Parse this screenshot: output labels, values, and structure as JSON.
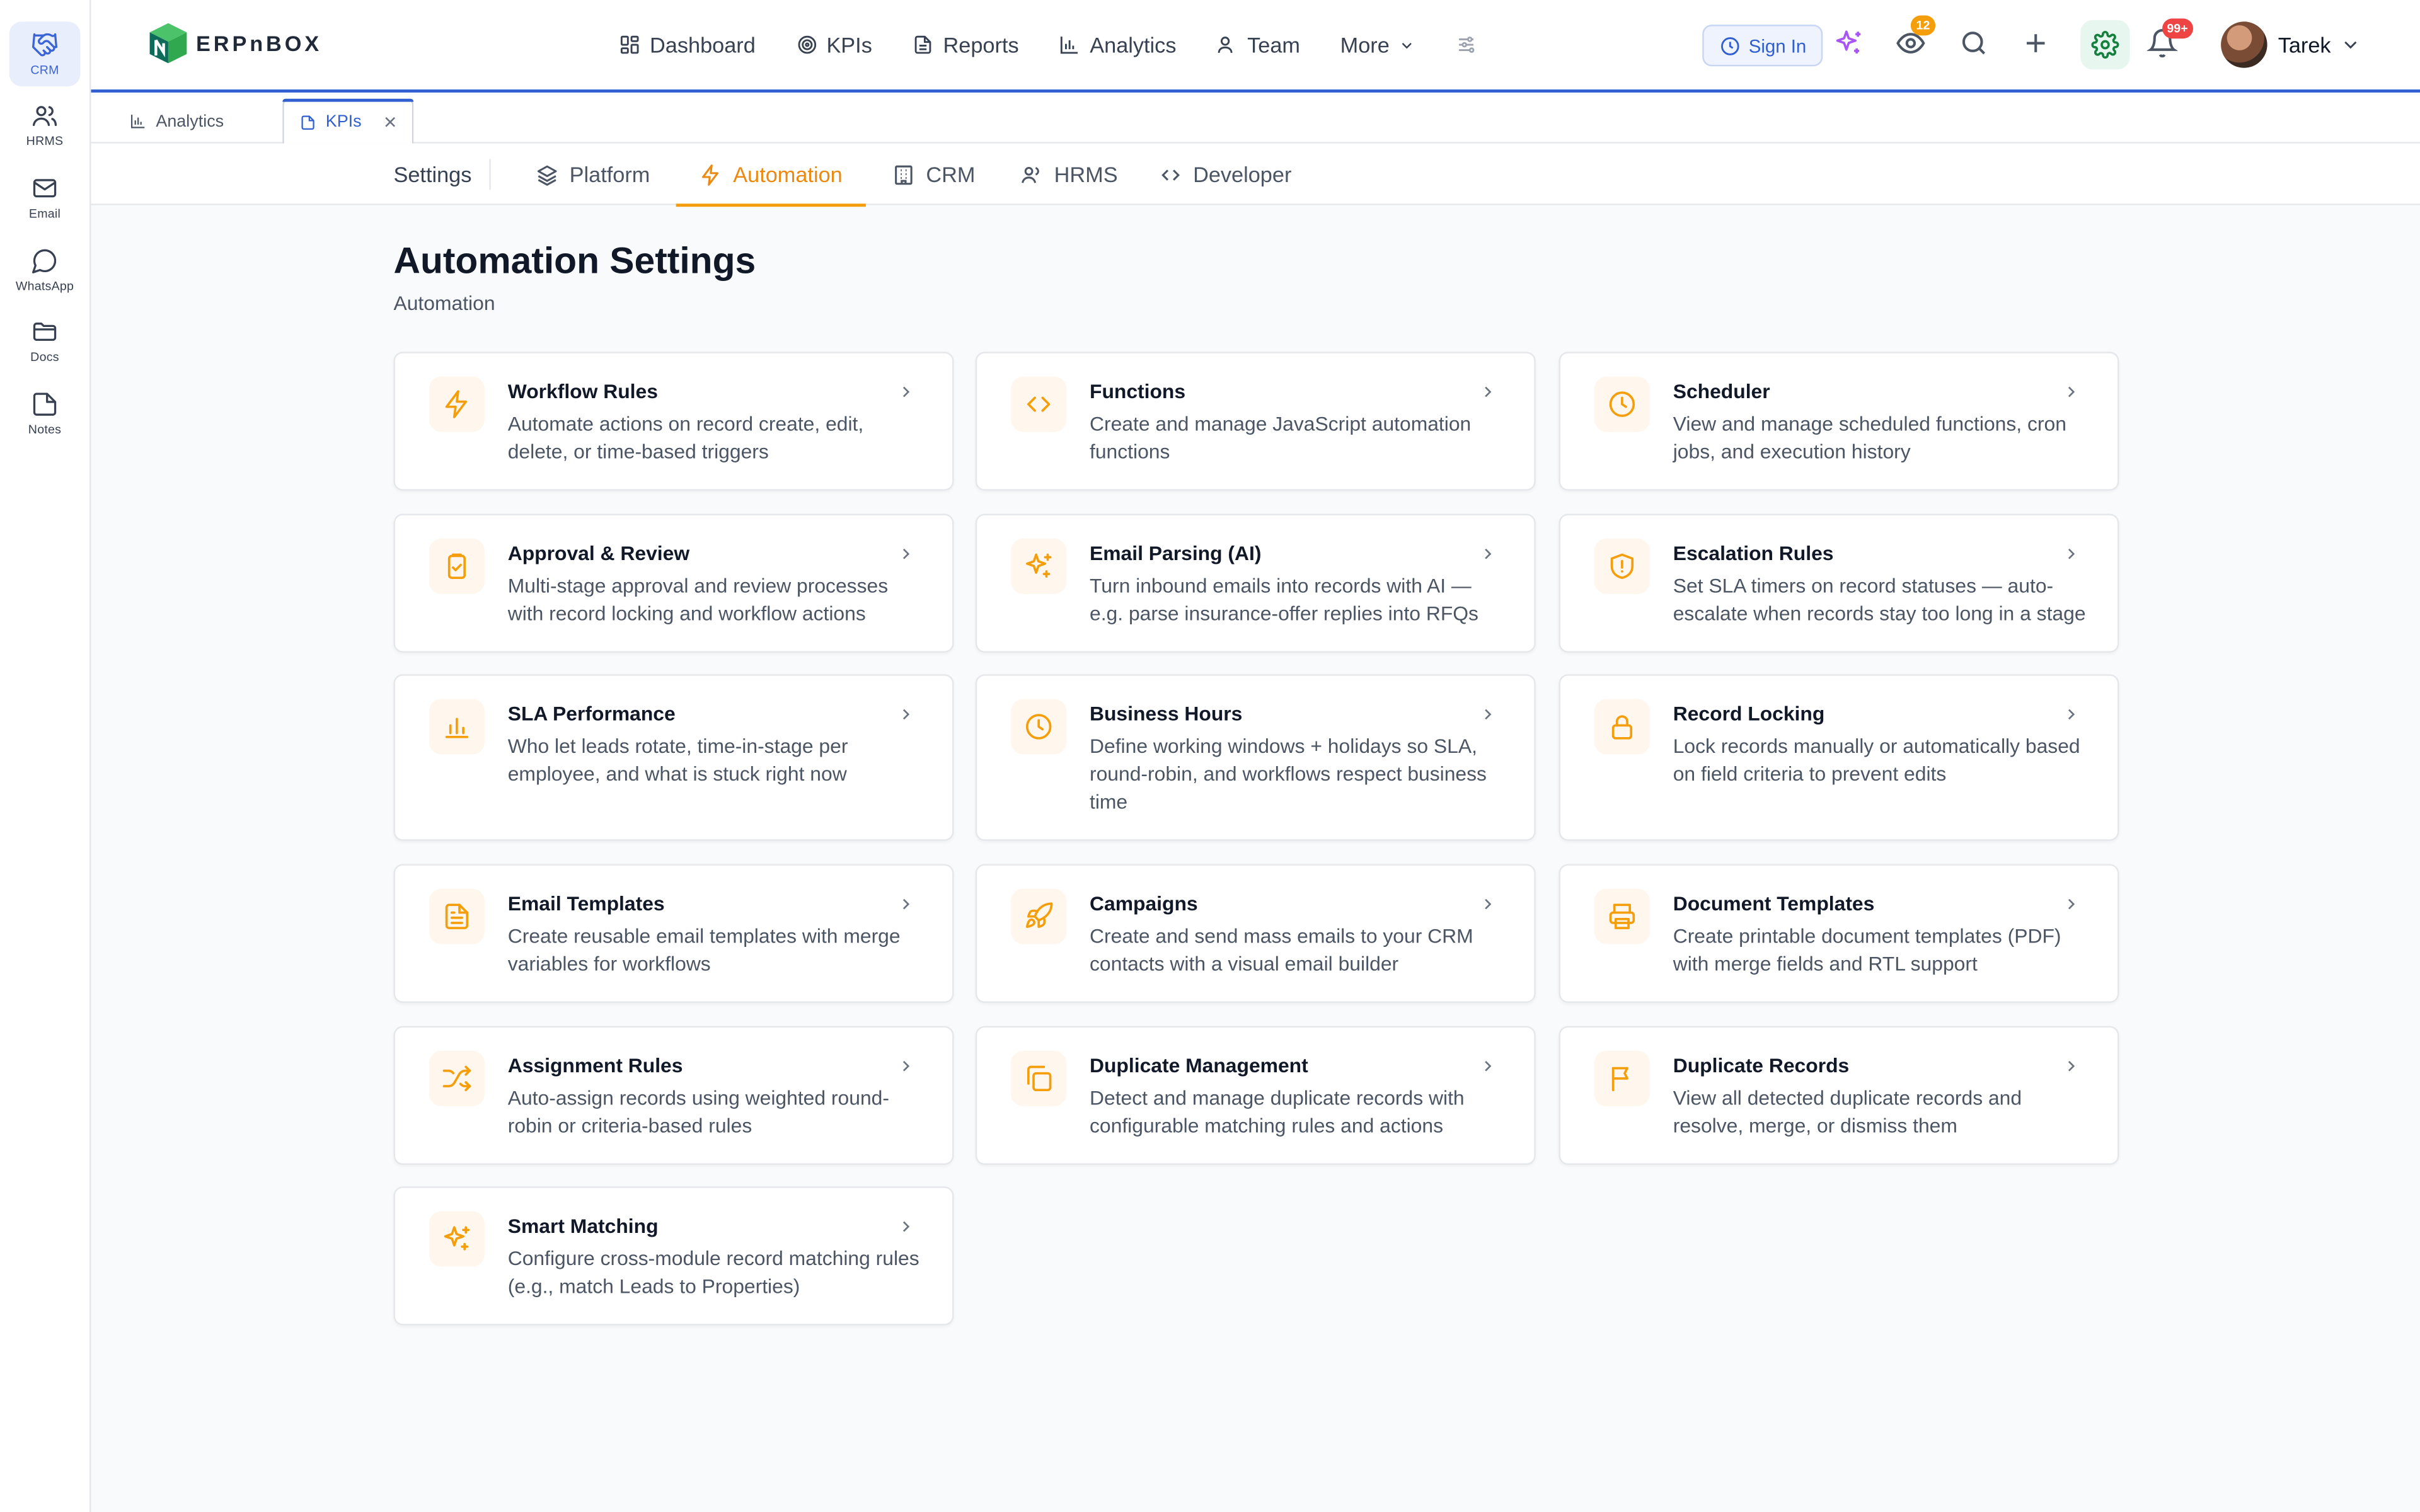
{
  "rail": [
    {
      "label": "CRM",
      "icon": "handshake-icon",
      "active": true
    },
    {
      "label": "HRMS",
      "icon": "users-icon"
    },
    {
      "label": "Email",
      "icon": "mail-icon"
    },
    {
      "label": "WhatsApp",
      "icon": "chat-bubble-icon"
    },
    {
      "label": "Docs",
      "icon": "folder-icon"
    },
    {
      "label": "Notes",
      "icon": "note-icon"
    }
  ],
  "brand": {
    "name": "ERPnBOX",
    "colors": {
      "green": "#2fa84f",
      "teal": "#0e6b5a"
    }
  },
  "nav": {
    "items": [
      {
        "label": "Dashboard",
        "icon": "dashboard-icon"
      },
      {
        "label": "KPIs",
        "icon": "target-icon"
      },
      {
        "label": "Reports",
        "icon": "report-icon"
      },
      {
        "label": "Analytics",
        "icon": "bar-chart-icon"
      },
      {
        "label": "Team",
        "icon": "user-icon"
      }
    ],
    "more_label": "More"
  },
  "top": {
    "sign_in": "Sign In",
    "watch_count": "12",
    "notif_count": "99+",
    "user_name": "Tarek"
  },
  "open_tabs": [
    {
      "label": "Analytics",
      "icon": "bar-chart-icon"
    },
    {
      "label": "KPIs",
      "icon": "file-icon",
      "active": true
    }
  ],
  "subnav": {
    "title": "Settings",
    "tabs": [
      {
        "label": "Platform",
        "icon": "layers-icon"
      },
      {
        "label": "Automation",
        "icon": "lightning-icon",
        "active": true
      },
      {
        "label": "CRM",
        "icon": "building-icon"
      },
      {
        "label": "HRMS",
        "icon": "users-icon"
      },
      {
        "label": "Developer",
        "icon": "code-icon"
      }
    ]
  },
  "page": {
    "title": "Automation Settings",
    "subtitle": "Automation"
  },
  "accent": "#f59e0b",
  "cards": [
    {
      "title": "Workflow Rules",
      "desc": "Automate actions on record create, edit, delete, or time-based triggers",
      "icon": "lightning-icon"
    },
    {
      "title": "Functions",
      "desc": "Create and manage JavaScript automation functions",
      "icon": "code-icon"
    },
    {
      "title": "Scheduler",
      "desc": "View and manage scheduled functions, cron jobs, and execution history",
      "icon": "clock-icon"
    },
    {
      "title": "Approval & Review",
      "desc": "Multi-stage approval and review processes with record locking and workflow actions",
      "icon": "clipboard-check-icon"
    },
    {
      "title": "Email Parsing (AI)",
      "desc": "Turn inbound emails into records with AI — e.g. parse insurance-offer replies into RFQs",
      "icon": "sparkles-icon"
    },
    {
      "title": "Escalation Rules",
      "desc": "Set SLA timers on record statuses — auto-escalate when records stay too long in a stage",
      "icon": "shield-alert-icon"
    },
    {
      "title": "SLA Performance",
      "desc": "Who let leads rotate, time-in-stage per employee, and what is stuck right now",
      "icon": "bar-chart-icon"
    },
    {
      "title": "Business Hours",
      "desc": "Define working windows + holidays so SLA, round-robin, and workflows respect business time",
      "icon": "clock-icon"
    },
    {
      "title": "Record Locking",
      "desc": "Lock records manually or automatically based on field criteria to prevent edits",
      "icon": "lock-icon"
    },
    {
      "title": "Email Templates",
      "desc": "Create reusable email templates with merge variables for workflows",
      "icon": "file-text-icon"
    },
    {
      "title": "Campaigns",
      "desc": "Create and send mass emails to your CRM contacts with a visual email builder",
      "icon": "rocket-icon"
    },
    {
      "title": "Document Templates",
      "desc": "Create printable document templates (PDF) with merge fields and RTL support",
      "icon": "printer-icon"
    },
    {
      "title": "Assignment Rules",
      "desc": "Auto-assign records using weighted round-robin or criteria-based rules",
      "icon": "shuffle-icon"
    },
    {
      "title": "Duplicate Management",
      "desc": "Detect and manage duplicate records with configurable matching rules and actions",
      "icon": "copy-icon"
    },
    {
      "title": "Duplicate Records",
      "desc": "View all detected duplicate records and resolve, merge, or dismiss them",
      "icon": "flag-icon"
    },
    {
      "title": "Smart Matching",
      "desc": "Configure cross-module record matching rules (e.g., match Leads to Properties)",
      "icon": "sparkles-icon"
    }
  ]
}
